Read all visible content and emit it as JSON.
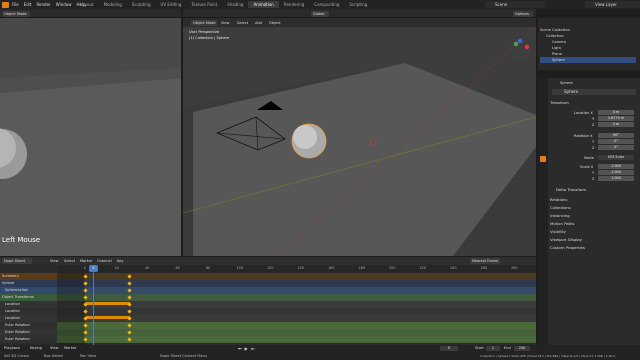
{
  "app": {
    "menu": [
      "File",
      "Edit",
      "Render",
      "Window",
      "Help"
    ]
  },
  "workspaces": [
    "Layout",
    "Modeling",
    "Sculpting",
    "UV Editing",
    "Texture Paint",
    "Shading",
    "Animation",
    "Rendering",
    "Compositing",
    "Scripting"
  ],
  "active_workspace": "Animation",
  "scene": "Scene",
  "view_layer": "View Layer",
  "left_viewport": {
    "mode": "Object Mode",
    "overlay_text": "Left Mouse"
  },
  "main_viewport": {
    "mode": "Object Mode",
    "menus": [
      "View",
      "Select",
      "Add",
      "Object"
    ],
    "transform": "Global",
    "options": "Options",
    "info1": "User Perspective",
    "info2": "(1) Collection | Sphere"
  },
  "outliner": {
    "items": [
      {
        "label": "Scene Collection"
      },
      {
        "label": "Collection"
      },
      {
        "label": "Camera"
      },
      {
        "label": "Light"
      },
      {
        "label": "Plane"
      },
      {
        "label": "Sphere"
      }
    ]
  },
  "properties": {
    "object": "Sphere",
    "object2": "Sphere",
    "transform_title": "Transform",
    "location_label": "Location X",
    "loc": [
      "0 m",
      "1.8779 m",
      "0 m"
    ],
    "rotation_label": "Rotation X",
    "rot": [
      "90°",
      "0°",
      "0°"
    ],
    "mode_label": "Mode",
    "mode_value": "XYZ Euler",
    "scale_label": "Scale X",
    "scale": [
      "1.000",
      "1.000",
      "1.000"
    ],
    "axis": [
      "Y",
      "Z"
    ],
    "sections": [
      "Delta Transform",
      "Relations",
      "Collections",
      "Instancing",
      "Motion Paths",
      "Visibility",
      "Viewport Display",
      "Custom Properties"
    ]
  },
  "dopesheet": {
    "mode": "Dope Sheet",
    "menus": [
      "View",
      "Select",
      "Marker",
      "Channel",
      "Key"
    ],
    "snap": "Nearest Frame",
    "ticks": [
      "0",
      "20",
      "40",
      "60",
      "80",
      "100",
      "120",
      "140",
      "160",
      "180",
      "200",
      "220",
      "240",
      "260",
      "280"
    ],
    "current_frame": "5",
    "channels": [
      "Summary",
      "Sphere",
      "SphereAction",
      "Object Transforms",
      "Location",
      "Location",
      "Location",
      "Euler Rotation",
      "Euler Rotation",
      "Euler Rotation"
    ]
  },
  "playback": {
    "playback": "Playback",
    "keying": "Keying",
    "view": "View",
    "marker": "Marker",
    "start_label": "Start",
    "start": "1",
    "end_label": "End",
    "end": "250",
    "frame": "5"
  },
  "statusbar": {
    "left": [
      "Set 3D Cursor",
      "Box Select",
      "Pan View"
    ],
    "center": "Dope Sheet Context Menu",
    "right": "Collection | Sphere | Verts:498 | Faces:513 | Tris:962 | Objects:1/4 | Mem:27.1 MiB | 2.90.0"
  },
  "colors": {
    "accent": "#e87d0d",
    "keyframe": "#ffb000",
    "hold": "#e08a00",
    "playhead": "#4b7fc4"
  }
}
